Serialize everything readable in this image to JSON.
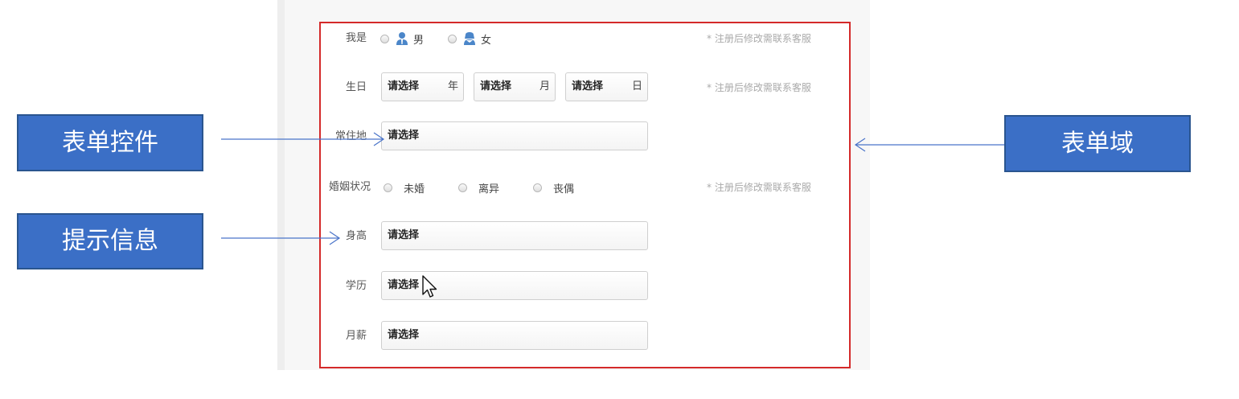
{
  "form": {
    "gender": {
      "label": "我是",
      "options": [
        {
          "label": "男",
          "icon": "male-user-icon"
        },
        {
          "label": "女",
          "icon": "female-user-icon"
        }
      ],
      "hint": "* 注册后修改需联系客服"
    },
    "birthday": {
      "label": "生日",
      "selects": [
        {
          "value": "请选择",
          "unit": "年"
        },
        {
          "value": "请选择",
          "unit": "月"
        },
        {
          "value": "请选择",
          "unit": "日"
        }
      ],
      "hint": "* 注册后修改需联系客服"
    },
    "residence": {
      "label": "常住地",
      "value": "请选择"
    },
    "marital": {
      "label": "婚姻状况",
      "options": [
        "未婚",
        "离异",
        "丧偶"
      ],
      "hint": "* 注册后修改需联系客服"
    },
    "height": {
      "label": "身高",
      "value": "请选择"
    },
    "education": {
      "label": "学历",
      "value": "请选择"
    },
    "salary": {
      "label": "月薪",
      "value": "请选择"
    }
  },
  "callouts": {
    "form_control": "表单控件",
    "hint_info": "提示信息",
    "form_field": "表单域"
  },
  "colors": {
    "callout_fill": "#3b6fc6",
    "form_border": "#d42a2a",
    "arrow": "#4a74c9",
    "hint_text": "#a9a9a9"
  }
}
